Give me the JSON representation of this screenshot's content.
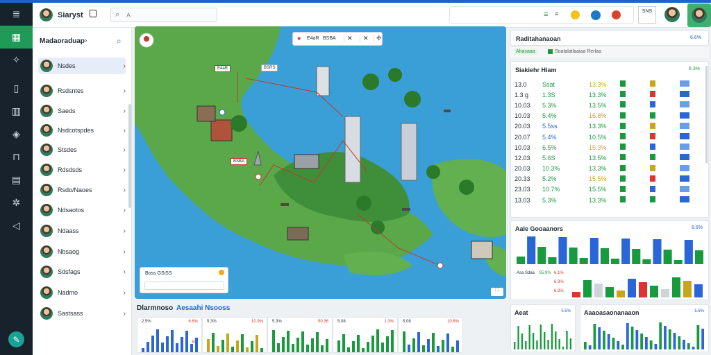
{
  "header": {
    "app_title": "Siaryst",
    "search_placeholder": "A",
    "right_code": "SNS"
  },
  "sidebar": {
    "title": "Madaoraduap",
    "contacts": [
      "Nsdes",
      "Rsdsntes",
      "Saeds",
      "Nsdcotspdes",
      "Stsdes",
      "Rdsdsds",
      "Rsdo/Naoes",
      "Ndsaotos",
      "Ndaass",
      "Nbsaog",
      "Sdsfags",
      "Nadmo",
      "Sastsass"
    ]
  },
  "map": {
    "callout_title": "Boss GSiSS",
    "labels": [
      "E4aR",
      "BSBA",
      "BSRS"
    ]
  },
  "bottom_panel": {
    "title": "Dlarmnoso",
    "subtitle": "Aesaahi Nsooss",
    "minis": [
      {
        "l": "2.5%",
        "r": "6.6%",
        "bot": "5%"
      },
      {
        "l": "5.3%",
        "r": "10.9%",
        "bot": ""
      },
      {
        "l": "5.3%",
        "r": "50.36",
        "bot": ""
      },
      {
        "l": "5.08",
        "r": "1.3%",
        "bot": ""
      },
      {
        "l": "5.08",
        "r": "10.8%",
        "bot": ""
      }
    ]
  },
  "right": {
    "header_title": "Raditahanaoan",
    "header_value": "6.6%",
    "filter_chip": "Ahasaaa",
    "filter_label": "Soatalatlaaiaa Rerlaa",
    "table_title": "Siakiehr Hiam",
    "table_value": "6.3%",
    "table": [
      {
        "a": "13.0",
        "b": "Ssat",
        "c": "13.3%",
        "dy": false
      },
      {
        "a": "1.3 g",
        "b": "1.3S",
        "c": "13.3%",
        "dy": false
      },
      {
        "a": "10.03",
        "b": "5.3%",
        "c": "13.5%",
        "dy": false
      },
      {
        "a": "10.03",
        "b": "5.4%",
        "c": "16.8%",
        "dy": false
      },
      {
        "a": "20.03",
        "b": "5.5ss",
        "c": "13.3%",
        "dy": true
      },
      {
        "a": "20.07",
        "b": "5.4%",
        "c": "10.5%",
        "dy": true
      },
      {
        "a": "10.03",
        "b": "6.5%",
        "c": "15.3%",
        "dy": false
      },
      {
        "a": "12.03",
        "b": "5.6S",
        "c": "13.5%",
        "dy": false
      },
      {
        "a": "20.03",
        "b": "10.3%",
        "c": "13.3%",
        "dy": false
      },
      {
        "a": "20.33",
        "b": "5.2%",
        "c": "15.5%",
        "dy": false
      },
      {
        "a": "23.03",
        "b": "10.7%",
        "c": "15.5%",
        "dy": false
      },
      {
        "a": "13.03",
        "b": "5.3%",
        "c": "13.3%",
        "dy": false
      }
    ],
    "chart1_title": "Aale Gooaanors",
    "chart1_value": "8.6%",
    "chart1_labels": [
      "Asa Sdaa",
      "S5.9%"
    ],
    "chart1_pct": [
      "6.1%",
      "6.3%",
      "6.3%"
    ],
    "chart2_title": "Aeat",
    "chart2_value": "5.5%",
    "chart3_title": "Aaaoasaonanaaon",
    "chart3_value": "5.6%"
  },
  "chart_data": {
    "type": "bar",
    "series": [
      {
        "values": [
          10,
          40,
          20,
          60,
          15,
          25,
          30,
          50,
          45,
          35
        ]
      }
    ]
  }
}
